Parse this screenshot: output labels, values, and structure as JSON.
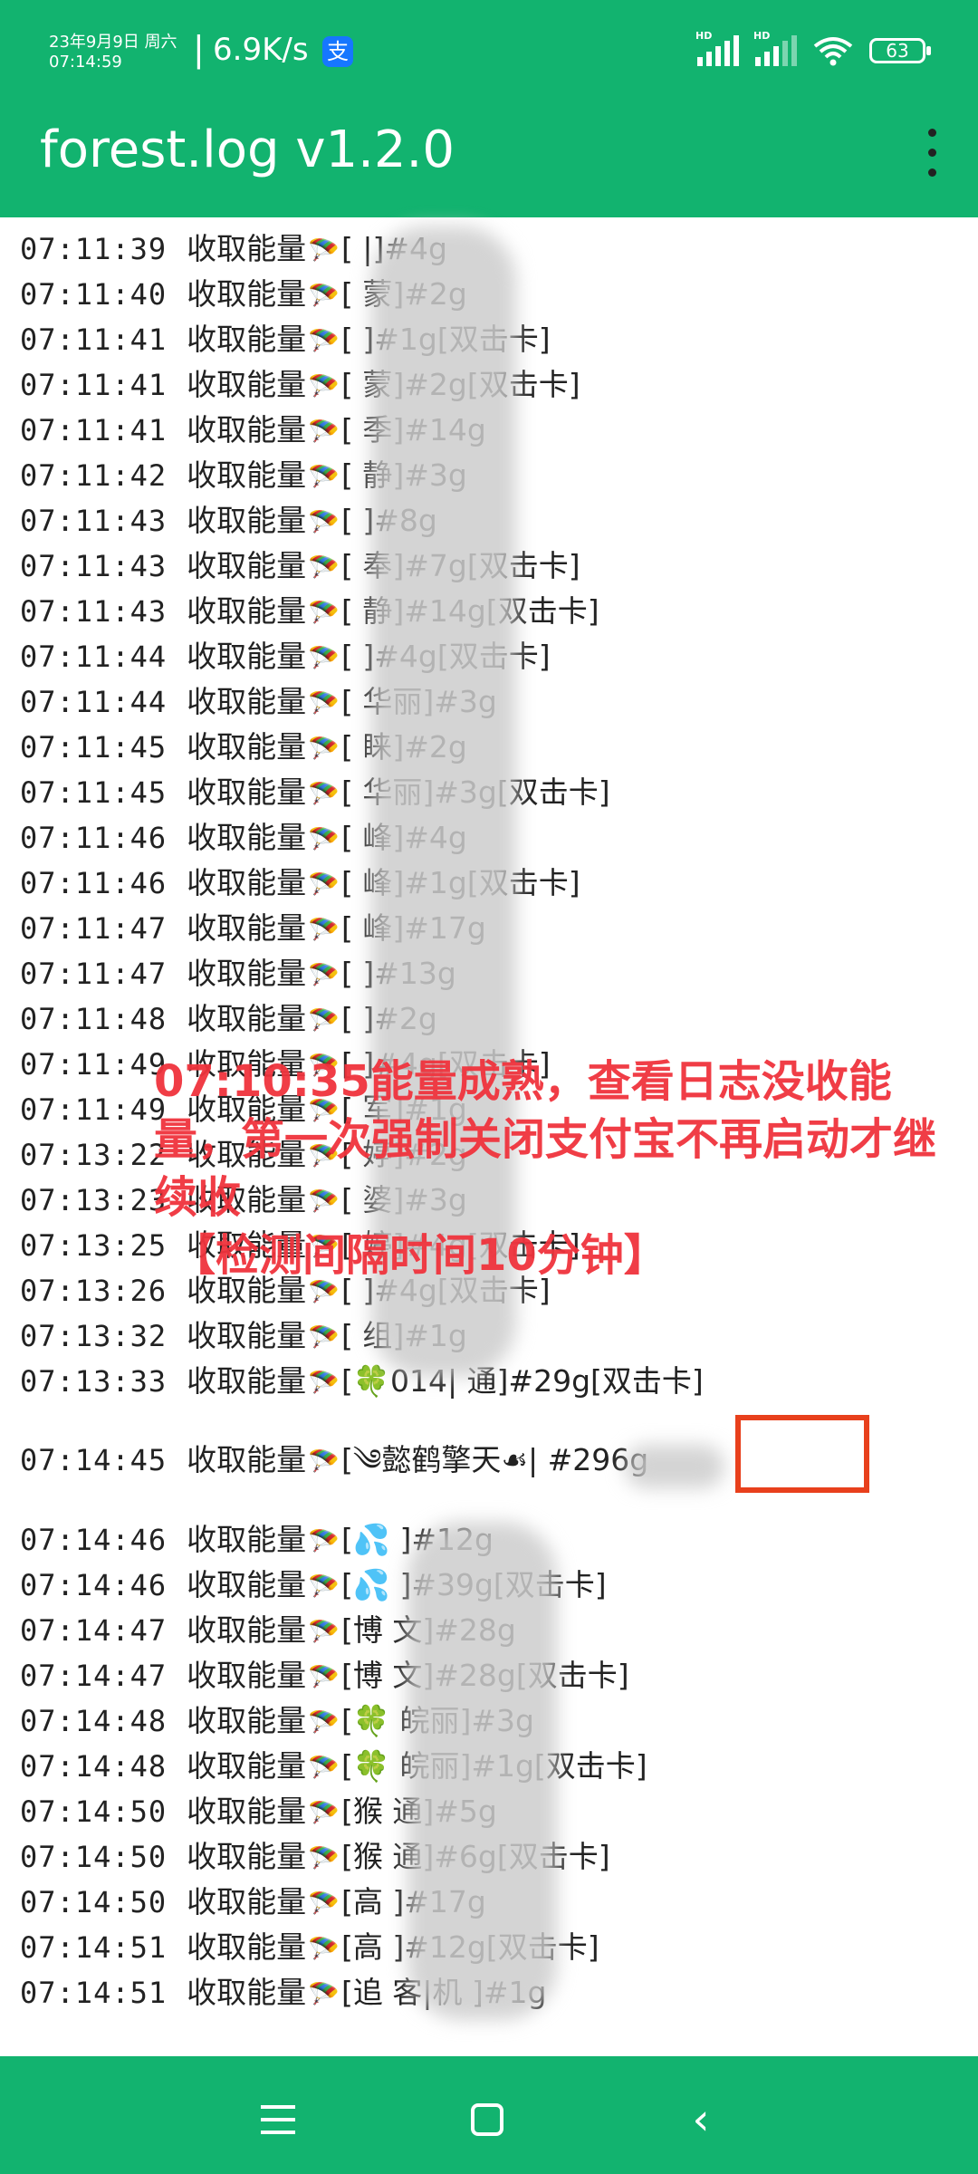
{
  "statusbar": {
    "date": "23年9月9日 周六",
    "time": "07:14:59",
    "net_speed": "6.9K/s",
    "app_badge": "支",
    "hd1": "HD",
    "hd2": "HD",
    "battery": "63"
  },
  "app": {
    "title": "forest.log v1.2.0"
  },
  "log": {
    "lines": [
      {
        "time": "07:11:39",
        "action": "收取能量",
        "detail": "[                  |]#4g"
      },
      {
        "time": "07:11:40",
        "action": "收取能量",
        "detail": "[                 蒙]#2g"
      },
      {
        "time": "07:11:41",
        "action": "收取能量",
        "detail": "[                  ]#1g[双击卡]"
      },
      {
        "time": "07:11:41",
        "action": "收取能量",
        "detail": "[                 蒙]#2g[双击卡]"
      },
      {
        "time": "07:11:41",
        "action": "收取能量",
        "detail": "[                 季]#14g"
      },
      {
        "time": "07:11:42",
        "action": "收取能量",
        "detail": "[                 静]#3g"
      },
      {
        "time": "07:11:43",
        "action": "收取能量",
        "detail": "[                  ]#8g"
      },
      {
        "time": "07:11:43",
        "action": "收取能量",
        "detail": "[                 奉]#7g[双击卡]"
      },
      {
        "time": "07:11:43",
        "action": "收取能量",
        "detail": "[                 静]#14g[双击卡]"
      },
      {
        "time": "07:11:44",
        "action": "收取能量",
        "detail": "[                  ]#4g[双击卡]"
      },
      {
        "time": "07:11:44",
        "action": "收取能量",
        "detail": "[                华丽]#3g"
      },
      {
        "time": "07:11:45",
        "action": "收取能量",
        "detail": "[                 睐]#2g"
      },
      {
        "time": "07:11:45",
        "action": "收取能量",
        "detail": "[                华丽]#3g[双击卡]"
      },
      {
        "time": "07:11:46",
        "action": "收取能量",
        "detail": "[                 峰]#4g"
      },
      {
        "time": "07:11:46",
        "action": "收取能量",
        "detail": "[                 峰]#1g[双击卡]"
      },
      {
        "time": "07:11:47",
        "action": "收取能量",
        "detail": "[                 峰]#17g"
      },
      {
        "time": "07:11:47",
        "action": "收取能量",
        "detail": "[                  ]#13g"
      },
      {
        "time": "07:11:48",
        "action": "收取能量",
        "detail": "[                  ]#2g"
      },
      {
        "time": "07:11:49",
        "action": "收取能量",
        "detail": "[                  ]#4g[双击卡]"
      },
      {
        "time": "07:11:49",
        "action": "收取能量",
        "detail": "[                 军]#1g"
      },
      {
        "time": "07:13:22",
        "action": "收取能量",
        "detail": "[                 婷]#2g"
      },
      {
        "time": "07:13:23",
        "action": "收取能量",
        "detail": "[                 婆]#3g"
      },
      {
        "time": "07:13:25",
        "action": "收取能量",
        "detail": "[                 婷]#4g[双击卡]"
      },
      {
        "time": "07:13:26",
        "action": "收取能量",
        "detail": "[                  ]#4g[双击卡]"
      },
      {
        "time": "07:13:32",
        "action": "收取能量",
        "detail": "[                 组]#1g"
      },
      {
        "time": "07:13:33",
        "action": "收取能量",
        "detail": "[🍀014|      通]#29g[双击卡]"
      },
      {
        "time": "07:14:45",
        "action": "收取能量",
        "detail": "[༄懿鹤擎天☙|           #296g"
      },
      {
        "time": "07:14:46",
        "action": "收取能量",
        "detail": "[💦               ]#12g"
      },
      {
        "time": "07:14:46",
        "action": "收取能量",
        "detail": "[💦              ]#39g[双击卡]"
      },
      {
        "time": "07:14:47",
        "action": "收取能量",
        "detail": "[博             文]#28g"
      },
      {
        "time": "07:14:47",
        "action": "收取能量",
        "detail": "[博             文]#28g[双击卡]"
      },
      {
        "time": "07:14:48",
        "action": "收取能量",
        "detail": "[🍀           皖丽]#3g"
      },
      {
        "time": "07:14:48",
        "action": "收取能量",
        "detail": "[🍀           皖丽]#1g[双击卡]"
      },
      {
        "time": "07:14:50",
        "action": "收取能量",
        "detail": "[猴             通]#5g"
      },
      {
        "time": "07:14:50",
        "action": "收取能量",
        "detail": "[猴             通]#6g[双击卡]"
      },
      {
        "time": "07:14:50",
        "action": "收取能量",
        "detail": "[高               ]#17g"
      },
      {
        "time": "07:14:51",
        "action": "收取能量",
        "detail": "[高               ]#12g[双击卡]"
      },
      {
        "time": "07:14:51",
        "action": "收取能量",
        "detail": "[追   客|机        ]#1g"
      }
    ]
  },
  "annotation": {
    "line1": "07:10:35能量成熟，查看日志没收能量，第一次强制关闭支付宝不再启动才继续收",
    "line2": "【检测间隔时间10分钟】"
  },
  "colors": {
    "primary": "#12b36f",
    "annotation": "#f0333d",
    "highlight": "#e8401c"
  },
  "icons": {
    "menu": "more-vert-icon",
    "action": "parachute-icon"
  }
}
